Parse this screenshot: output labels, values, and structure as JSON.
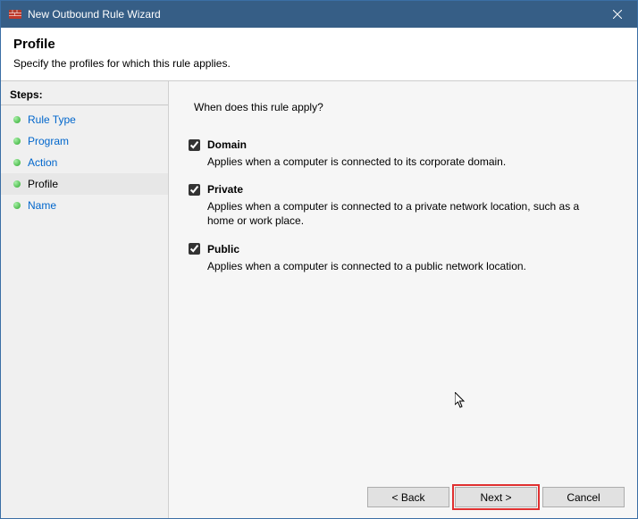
{
  "window": {
    "title": "New Outbound Rule Wizard"
  },
  "header": {
    "heading": "Profile",
    "subheading": "Specify the profiles for which this rule applies."
  },
  "sidebar": {
    "title": "Steps:",
    "items": [
      {
        "label": "Rule Type",
        "state": "link"
      },
      {
        "label": "Program",
        "state": "link"
      },
      {
        "label": "Action",
        "state": "link"
      },
      {
        "label": "Profile",
        "state": "current"
      },
      {
        "label": "Name",
        "state": "link"
      }
    ]
  },
  "main": {
    "prompt": "When does this rule apply?",
    "options": [
      {
        "label": "Domain",
        "checked": true,
        "desc": "Applies when a computer is connected to its corporate domain."
      },
      {
        "label": "Private",
        "checked": true,
        "desc": "Applies when a computer is connected to a private network location, such as a home or work place."
      },
      {
        "label": "Public",
        "checked": true,
        "desc": "Applies when a computer is connected to a public network location."
      }
    ]
  },
  "buttons": {
    "back": "< Back",
    "next": "Next >",
    "cancel": "Cancel"
  }
}
